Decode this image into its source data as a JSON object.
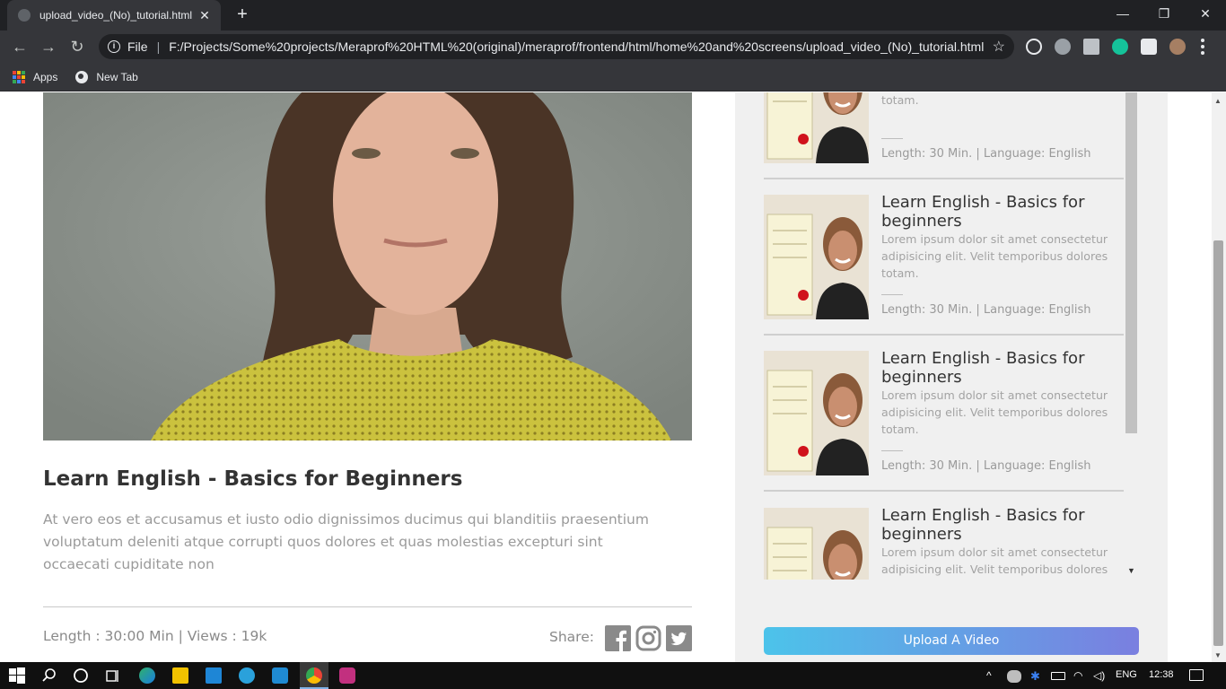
{
  "browser": {
    "tab_title": "upload_video_(No)_tutorial.html",
    "tab_close": "✕",
    "new_tab": "+",
    "window_controls": {
      "minimize": "—",
      "restore": "❐",
      "close": "✕"
    },
    "nav": {
      "back": "←",
      "forward": "→",
      "reload": "↻"
    },
    "omnibox": {
      "info": "i",
      "scheme": "File",
      "separator": "|",
      "url": "F:/Projects/Some%20projects/Meraprof%20HTML%20(original)/meraprof/frontend/html/home%20and%20screens/upload_video_(No)_tutorial.html",
      "star": "☆"
    },
    "bookmarks": [
      {
        "label": "Apps",
        "icon": "apps-grid-icon"
      },
      {
        "label": "New Tab",
        "icon": "globe-icon"
      }
    ],
    "extension_icons": [
      "react-icon",
      "compass-icon",
      "bookmark-icon",
      "grammarly-icon",
      "puzzle-icon",
      "profile-avatar",
      "kebab-menu-icon"
    ]
  },
  "video": {
    "title": "Learn English - Basics for Beginners",
    "description": "At vero eos et accusamus et iusto odio dignissimos ducimus qui blanditiis praesentium voluptatum deleniti atque corrupti quos dolores et quas molestias excepturi sint occaecati cupiditate non",
    "meta": "Length : 30:00 Min | Views : 19k",
    "share_label": "Share:",
    "share_icons": [
      "facebook-icon",
      "instagram-icon",
      "twitter-icon"
    ]
  },
  "playlist": {
    "cards": [
      {
        "title": "",
        "description": "adipisicing elit. Velit temporibus dolores totam.",
        "meta": "Length: 30 Min. | Language: English"
      },
      {
        "title": "Learn English - Basics for beginners",
        "description": "Lorem ipsum dolor sit amet consectetur adipisicing elit. Velit temporibus dolores totam.",
        "meta": "Length: 30 Min. | Language: English"
      },
      {
        "title": "Learn English - Basics for beginners",
        "description": "Lorem ipsum dolor sit amet consectetur adipisicing elit. Velit temporibus dolores totam.",
        "meta": "Length: 30 Min. | Language: English"
      },
      {
        "title": "Learn English - Basics for beginners",
        "description": "Lorem ipsum dolor sit amet consectetur adipisicing elit. Velit temporibus dolores",
        "meta": ""
      }
    ],
    "upload_button": "Upload A Video"
  },
  "taskbar": {
    "language": "ENG",
    "time": "12:38",
    "apps": [
      "windows-start-icon",
      "search-icon",
      "cortana-icon",
      "task-view-icon",
      "edge-icon",
      "file-explorer-icon",
      "mail-icon",
      "telegram-icon",
      "vscode-icon",
      "chrome-icon",
      "app-icon"
    ]
  },
  "colors": {
    "accent_gradient_start": "#4cc3ea",
    "accent_gradient_end": "#7a7fe0",
    "title_text": "#333333",
    "muted_text": "#9a9a9a",
    "sidebar_bg": "#f0f0f0"
  }
}
